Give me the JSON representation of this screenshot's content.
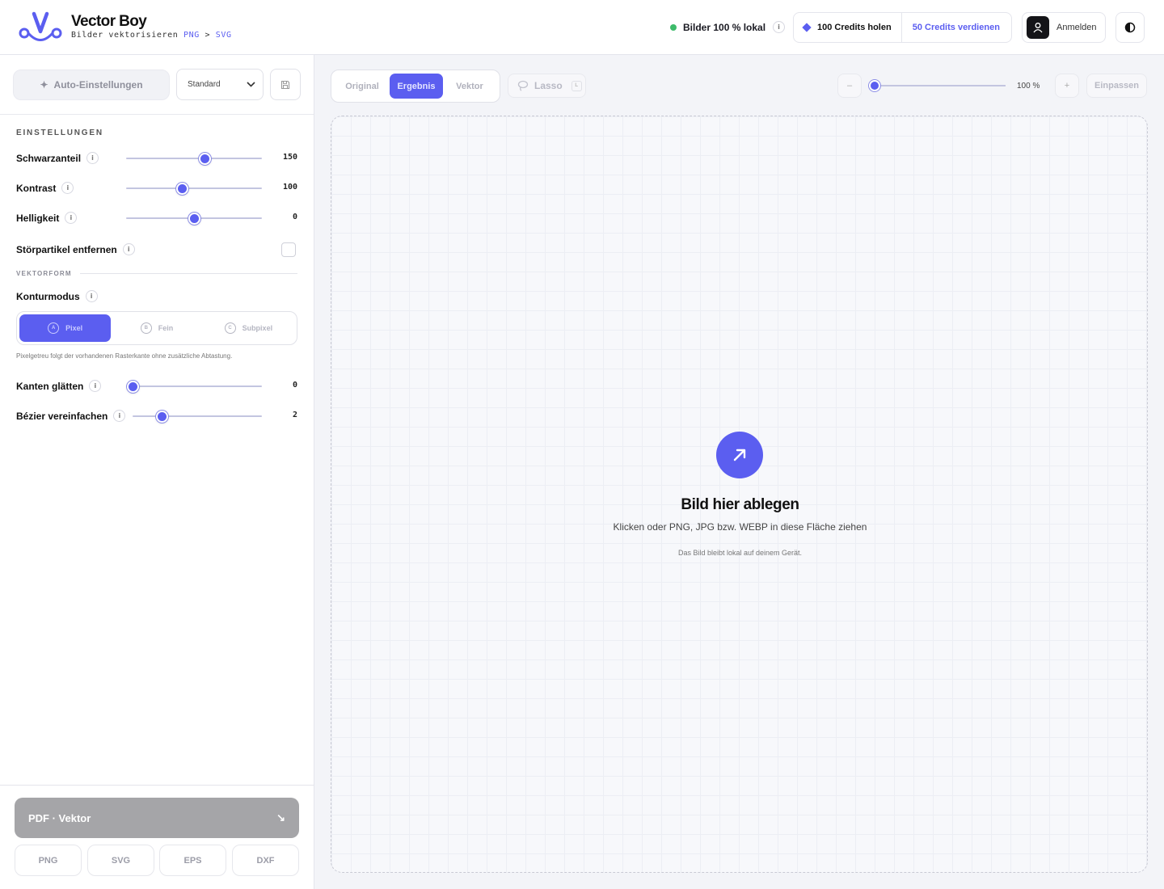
{
  "header": {
    "title": "Vector Boy",
    "subtitle_prefix": "Bilder vektorisieren",
    "subtitle_from": "PNG",
    "subtitle_sep": ">",
    "subtitle_to": "SVG",
    "local_status": "Bilder 100 % lokal",
    "info_glyph": "i",
    "credits_button": "100 Credits holen",
    "earn_button": "50 Credits verdienen",
    "login_button": "Anmelden",
    "status_color": "#3dbb6a",
    "accent_color": "#5b5ef0"
  },
  "sidebar": {
    "auto_settings": "Auto-Einstellungen",
    "preset": {
      "selected": "Standard"
    },
    "section_title": "EINSTELLUNGEN",
    "settings": [
      {
        "label": "Schwarzanteil",
        "value": "150"
      },
      {
        "label": "Kontrast",
        "value": "100"
      },
      {
        "label": "Helligkeit",
        "value": "0"
      }
    ],
    "despeckle": {
      "label": "Störpartikel entfernen",
      "checked": false
    },
    "vector_section": "VEKTORFORM",
    "contour": {
      "label": "Konturmodus",
      "options": [
        {
          "key": "A",
          "label": "Pixel",
          "active": true
        },
        {
          "key": "B",
          "label": "Fein",
          "active": false
        },
        {
          "key": "C",
          "label": "Subpixel",
          "active": false
        }
      ],
      "hint": "Pixelgetreu folgt der vorhandenen Rasterkante ohne zusätzliche Abtastung."
    },
    "shape_settings": [
      {
        "label": "Kanten glätten",
        "value": "0"
      },
      {
        "label": "Bézier vereinfachen",
        "value": "2"
      }
    ],
    "export": {
      "main_label": "PDF · Vektor",
      "main_arrow": "↘",
      "formats": [
        "PNG",
        "SVG",
        "EPS",
        "DXF"
      ]
    }
  },
  "main": {
    "tabs": [
      {
        "label": "Original",
        "active": false
      },
      {
        "label": "Ergebnis",
        "active": true
      },
      {
        "label": "Vektor",
        "active": false
      }
    ],
    "lasso": {
      "label": "Lasso",
      "shortcut": "L"
    },
    "zoom": {
      "minus": "–",
      "plus": "+",
      "value": "100 %",
      "fit": "Einpassen"
    },
    "dropzone": {
      "title": "Bild hier ablegen",
      "subtitle": "Klicken oder PNG, JPG bzw. WEBP in diese Fläche ziehen",
      "note": "Das Bild bleibt lokal auf deinem Gerät."
    }
  }
}
